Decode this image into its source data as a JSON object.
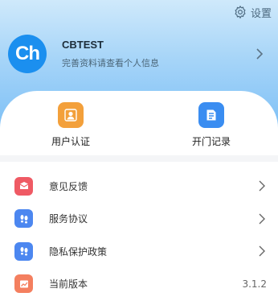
{
  "colors": {
    "header_top": "#cfe9fb",
    "header_bottom": "#7ec0f6",
    "avatar": "#1b8fef",
    "user_cert_icon": "#f3a03b",
    "door_record_icon": "#3a8df1",
    "feedback_icon": "#ef5a64",
    "protocol_icon": "#4c87f0",
    "privacy_icon": "#4c87f0",
    "version_icon": "#f47f5f"
  },
  "header": {
    "settings_label": "设置",
    "settings_icon": "gear-icon"
  },
  "profile": {
    "avatar_text": "Ch",
    "name": "CBTEST",
    "subtitle": "完善资料请查看个人信息"
  },
  "quick_actions": [
    {
      "label": "用户认证",
      "icon": "user-badge-icon"
    },
    {
      "label": "开门记录",
      "icon": "document-edit-icon"
    }
  ],
  "menu": [
    {
      "label": "意见反馈",
      "icon": "mail-icon"
    },
    {
      "label": "服务协议",
      "icon": "footprints-icon"
    },
    {
      "label": "隐私保护政策",
      "icon": "footprints-icon"
    },
    {
      "label": "当前版本",
      "icon": "chart-icon",
      "value": "3.1.2"
    }
  ]
}
